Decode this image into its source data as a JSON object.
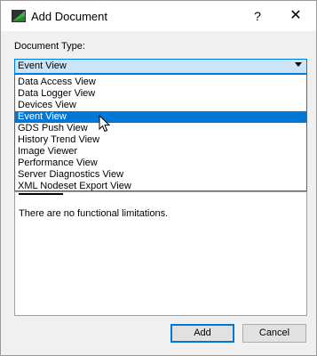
{
  "window": {
    "title": "Add Document",
    "help_label": "?",
    "close_label": "✕"
  },
  "form": {
    "document_type_label": "Document Type:",
    "selected_value": "Event View"
  },
  "dropdown": {
    "options": [
      "Data Access View",
      "Data Logger View",
      "Devices View",
      "Event View",
      "GDS Push View",
      "History Trend View",
      "Image Viewer",
      "Performance View",
      "Server Diagnostics View",
      "XML Nodeset Export View"
    ],
    "highlighted_index": 3
  },
  "description": {
    "text": "There are no functional limitations."
  },
  "buttons": {
    "add_label": "Add",
    "cancel_label": "Cancel"
  },
  "colors": {
    "selection": "#0078d7",
    "combo_background": "#cce4f7"
  }
}
